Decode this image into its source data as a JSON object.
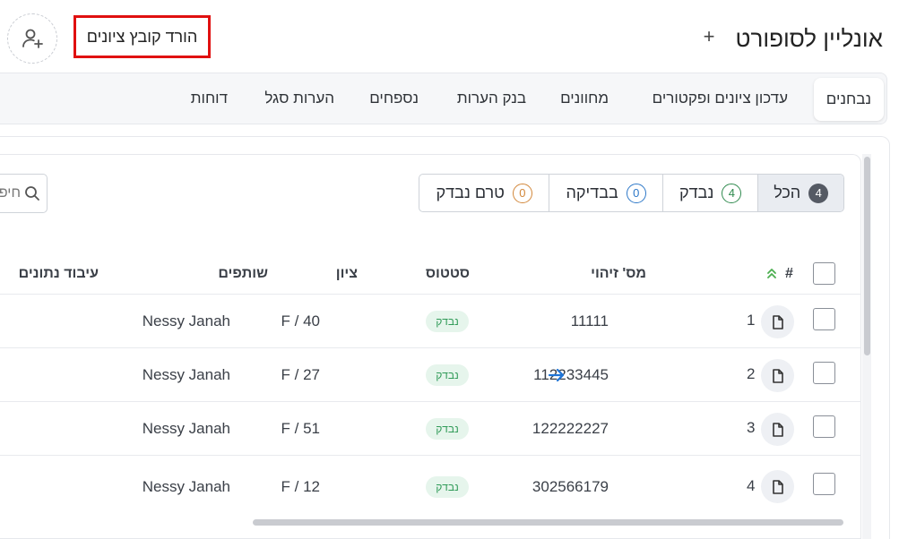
{
  "header": {
    "title": "אונליין לסופורט",
    "add_icon": "plus-icon",
    "download_label": "הורד קובץ ציונים",
    "add_user_icon": "user-plus-icon"
  },
  "tabs": [
    {
      "label": "נבחנים",
      "active": true
    },
    {
      "label": "עדכון ציונים ופקטורים"
    },
    {
      "label": "מחוונים"
    },
    {
      "label": "בנק הערות"
    },
    {
      "label": "נספחים"
    },
    {
      "label": "הערות סגל"
    },
    {
      "label": "דוחות"
    }
  ],
  "filters": [
    {
      "label": "הכל",
      "count": "4"
    },
    {
      "label": "נבדק",
      "count": "4"
    },
    {
      "label": "בבדיקה",
      "count": "0"
    },
    {
      "label": "טרם נבדק",
      "count": "0"
    }
  ],
  "search": {
    "placeholder": "חיפוש"
  },
  "table": {
    "headers": {
      "index": "#",
      "id": "מס' זיהוי",
      "status": "סטטוס",
      "grade": "ציון",
      "partners": "שותפים",
      "processing": "עיבוד נתונים"
    },
    "rows": [
      {
        "num": "1",
        "id": "11111",
        "status": "נבדק",
        "grade": "F / 40",
        "partner": "Nessy Janah"
      },
      {
        "num": "2",
        "id": "112233445",
        "status": "נבדק",
        "grade": "F / 27",
        "partner": "Nessy Janah"
      },
      {
        "num": "3",
        "id": "122222227",
        "status": "נבדק",
        "grade": "F / 51",
        "partner": "Nessy Janah"
      },
      {
        "num": "4",
        "id": "302566179",
        "status": "נבדק",
        "grade": "F / 12",
        "partner": "Nessy Janah"
      }
    ]
  },
  "colors": {
    "accent_red": "#e01010",
    "status_green": "#2f9a57",
    "link_blue": "#1f74d6"
  }
}
